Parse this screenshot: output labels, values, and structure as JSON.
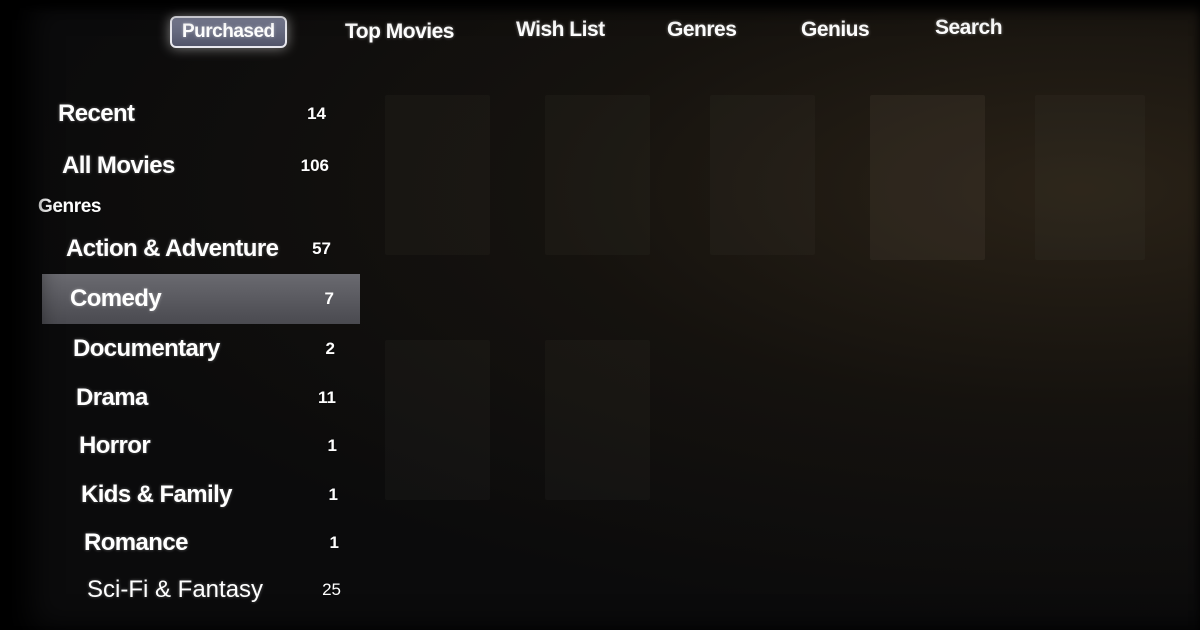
{
  "top_nav": {
    "tabs": [
      {
        "label": "Purchased",
        "active": true
      },
      {
        "label": "Top Movies"
      },
      {
        "label": "Wish List"
      },
      {
        "label": "Genres"
      },
      {
        "label": "Genius"
      },
      {
        "label": "Search"
      }
    ]
  },
  "sidebar": {
    "recent": {
      "label": "Recent",
      "count": "14"
    },
    "all_movies": {
      "label": "All Movies",
      "count": "106"
    },
    "genres_heading": "Genres",
    "genres": [
      {
        "label": "Action & Adventure",
        "count": "57"
      },
      {
        "label": "Comedy",
        "count": "7",
        "selected": true
      },
      {
        "label": "Documentary",
        "count": "2"
      },
      {
        "label": "Drama",
        "count": "11"
      },
      {
        "label": "Horror",
        "count": "1"
      },
      {
        "label": "Kids & Family",
        "count": "1"
      },
      {
        "label": "Romance",
        "count": "1"
      },
      {
        "label": "Sci-Fi & Fantasy",
        "count": "25"
      }
    ]
  },
  "colors": {
    "selection": "#5a5a60",
    "background": "#0b0b0c"
  }
}
